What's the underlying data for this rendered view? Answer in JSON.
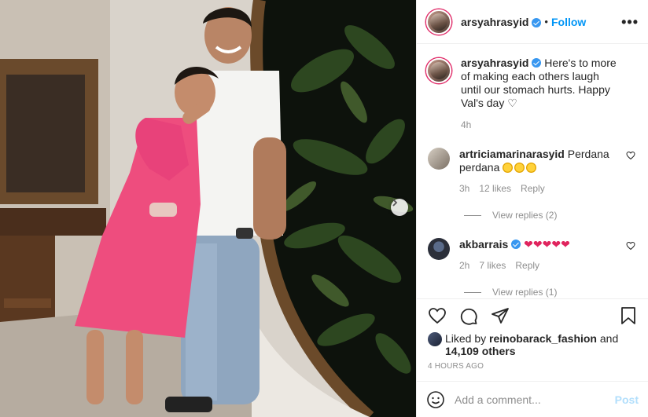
{
  "post": {
    "author": "arsyahrasyid",
    "follow_label": "Follow",
    "dot": "•",
    "more_label": "•••"
  },
  "caption": {
    "username": "arsyahrasyid",
    "text": "Here's to more of making each others laugh until our stomach hurts. Happy Val's day ♡",
    "time": "4h"
  },
  "comments": [
    {
      "username": "artriciamarinarasyid",
      "text": "Perdana perdana",
      "time": "3h",
      "likes": "12 likes",
      "reply_label": "Reply",
      "view_replies": "View replies (2)"
    },
    {
      "username": "akbarrais",
      "text": "❤❤❤❤❤",
      "time": "2h",
      "likes": "7 likes",
      "reply_label": "Reply",
      "view_replies": "View replies (1)"
    }
  ],
  "likes": {
    "prefix": "Liked by",
    "user": "reinobarack_fashion",
    "and": "and",
    "others": "14,109 others"
  },
  "time_ago": "4 HOURS AGO",
  "add_comment": {
    "placeholder": "Add a comment...",
    "post_label": "Post"
  },
  "colors": {
    "accent": "#0095f6",
    "verified": "#3897f0",
    "muted": "#8e8e8e",
    "text": "#262626",
    "heart": "#e0245e"
  }
}
